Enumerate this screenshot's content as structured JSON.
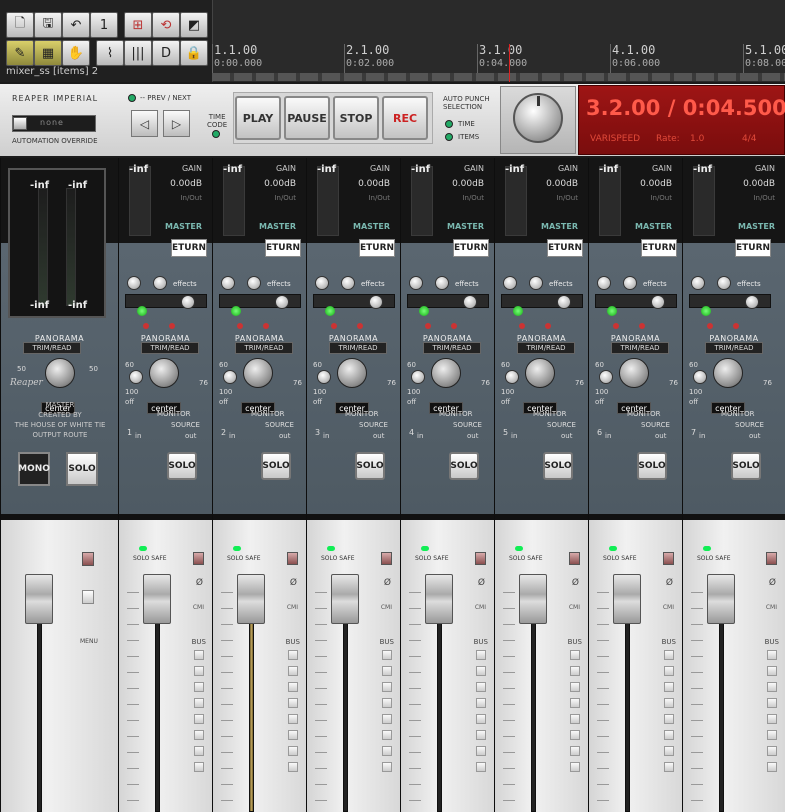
{
  "toolbar": {
    "buttons": [
      {
        "name": "new-project-icon",
        "glyph": "🗋"
      },
      {
        "name": "save-icon",
        "glyph": "🖫"
      },
      {
        "name": "undo-icon",
        "glyph": "↶"
      },
      {
        "name": "track-1-icon",
        "glyph": "1"
      },
      {
        "name": "grid-icon",
        "glyph": "⊞"
      },
      {
        "name": "snap-icon",
        "glyph": "⟲"
      },
      {
        "name": "metronome-icon",
        "glyph": "◩"
      },
      {
        "name": "record-cursor-icon",
        "glyph": "✎"
      },
      {
        "name": "ripple-icon",
        "glyph": "▦"
      },
      {
        "name": "hand-icon",
        "glyph": "✋"
      },
      {
        "name": "envelope-icon",
        "glyph": "⌇"
      },
      {
        "name": "lane-icon",
        "glyph": "|||"
      },
      {
        "name": "loop-icon",
        "glyph": "D"
      },
      {
        "name": "lock-icon",
        "glyph": "🔒"
      }
    ],
    "mixer_label": "mixer_ss [items] 2"
  },
  "ruler": {
    "marks": [
      {
        "bar": "1.1.00",
        "time": "0:00.000"
      },
      {
        "bar": "2.1.00",
        "time": "0:02.000"
      },
      {
        "bar": "3.1.00",
        "time": "0:04.000"
      },
      {
        "bar": "4.1.00",
        "time": "0:06.000"
      },
      {
        "bar": "5.1.00",
        "time": "0:08.000"
      }
    ]
  },
  "transport": {
    "brand": "REAPER IMPERIAL",
    "override_value": "none",
    "override_label": "AUTOMATION OVERRIDE",
    "prevnext_label": "-- PREV / NEXT",
    "prev_glyph": "◁",
    "next_glyph": "▷",
    "timecode_label_1": "TIME",
    "timecode_label_2": "CODE",
    "play": "PLAY",
    "pause": "PAUSE",
    "stop": "STOP",
    "rec": "REC",
    "autopunch_1": "AUTO PUNCH",
    "autopunch_2": "SELECTION",
    "ap_time": "TIME",
    "ap_items": "ITEMS"
  },
  "display": {
    "time": "3.2.00 / 0:04.500",
    "varispeed": "VARISPEED",
    "rate_label": "Rate:",
    "rate_value": "1.0",
    "signature": "4/4"
  },
  "master": {
    "meter_top_left": "-inf",
    "meter_top_right": "-inf",
    "meter_bottom_left": "-inf",
    "meter_bottom_right": "-inf",
    "logo": "Reaper",
    "credits_1": "MASTER",
    "credits_2": "CREATED BY",
    "credits_3": "THE HOUSE OF WHITE TIE",
    "output_route": "OUTPUT ROUTE",
    "panorama": "PANORAMA",
    "trim": "TRIM/READ",
    "pan_left": "50",
    "pan_right": "50",
    "center": "center",
    "mono": "MONO",
    "solo": "SOLO",
    "menu": "MENU"
  },
  "channels": [
    {
      "num": "1",
      "meter": "-inf",
      "gain_label": "GAIN",
      "gain": "0.00dB",
      "inout": "In/Out",
      "master": "MASTER",
      "fx": "ETURN",
      "effects": "effects",
      "panorama": "PANORAMA",
      "trim": "TRIM/READ",
      "center": "center",
      "monitor": "MONITOR",
      "source": "SOURCE",
      "in": "in",
      "out": "out",
      "solo": "SOLO",
      "solo_safe": "SOLO SAFE",
      "bus": "BUS",
      "phase": "Ø",
      "cmi": "CMI",
      "scale_60": "60",
      "scale_100": "100",
      "scale_off": "off",
      "scale_76": "76"
    },
    {
      "num": "2",
      "meter": "-inf",
      "gain_label": "GAIN",
      "gain": "0.00dB",
      "inout": "In/Out",
      "master": "MASTER",
      "fx": "ETURN",
      "effects": "effects",
      "panorama": "PANORAMA",
      "trim": "TRIM/READ",
      "center": "center",
      "monitor": "MONITOR",
      "source": "SOURCE",
      "in": "in",
      "out": "out",
      "solo": "SOLO",
      "solo_safe": "SOLO SAFE",
      "bus": "BUS",
      "phase": "Ø",
      "cmi": "CMI",
      "scale_60": "60",
      "scale_100": "100",
      "scale_off": "off",
      "scale_76": "76"
    },
    {
      "num": "3",
      "meter": "-inf",
      "gain_label": "GAIN",
      "gain": "0.00dB",
      "inout": "In/Out",
      "master": "MASTER",
      "fx": "ETURN",
      "effects": "effects",
      "panorama": "PANORAMA",
      "trim": "TRIM/READ",
      "center": "center",
      "monitor": "MONITOR",
      "source": "SOURCE",
      "in": "in",
      "out": "out",
      "solo": "SOLO",
      "solo_safe": "SOLO SAFE",
      "bus": "BUS",
      "phase": "Ø",
      "cmi": "CMI",
      "scale_60": "60",
      "scale_100": "100",
      "scale_off": "off",
      "scale_76": "76"
    },
    {
      "num": "4",
      "meter": "-inf",
      "gain_label": "GAIN",
      "gain": "0.00dB",
      "inout": "In/Out",
      "master": "MASTER",
      "fx": "ETURN",
      "effects": "effects",
      "panorama": "PANORAMA",
      "trim": "TRIM/READ",
      "center": "center",
      "monitor": "MONITOR",
      "source": "SOURCE",
      "in": "in",
      "out": "out",
      "solo": "SOLO",
      "solo_safe": "SOLO SAFE",
      "bus": "BUS",
      "phase": "Ø",
      "cmi": "CMI",
      "scale_60": "60",
      "scale_100": "100",
      "scale_off": "off",
      "scale_76": "76"
    },
    {
      "num": "5",
      "meter": "-inf",
      "gain_label": "GAIN",
      "gain": "0.00dB",
      "inout": "In/Out",
      "master": "MASTER",
      "fx": "ETURN",
      "effects": "effects",
      "panorama": "PANORAMA",
      "trim": "TRIM/READ",
      "center": "center",
      "monitor": "MONITOR",
      "source": "SOURCE",
      "in": "in",
      "out": "out",
      "solo": "SOLO",
      "solo_safe": "SOLO SAFE",
      "bus": "BUS",
      "phase": "Ø",
      "cmi": "CMI",
      "scale_60": "60",
      "scale_100": "100",
      "scale_off": "off",
      "scale_76": "76"
    },
    {
      "num": "6",
      "meter": "-inf",
      "gain_label": "GAIN",
      "gain": "0.00dB",
      "inout": "In/Out",
      "master": "MASTER",
      "fx": "ETURN",
      "effects": "effects",
      "panorama": "PANORAMA",
      "trim": "TRIM/READ",
      "center": "center",
      "monitor": "MONITOR",
      "source": "SOURCE",
      "in": "in",
      "out": "out",
      "solo": "SOLO",
      "solo_safe": "SOLO SAFE",
      "bus": "BUS",
      "phase": "Ø",
      "cmi": "CMI",
      "scale_60": "60",
      "scale_100": "100",
      "scale_off": "off",
      "scale_76": "76"
    },
    {
      "num": "7",
      "meter": "-inf",
      "gain_label": "GAIN",
      "gain": "0.00dB",
      "inout": "In/Out",
      "master": "MASTER",
      "fx": "ETURN",
      "effects": "effects",
      "panorama": "PANORAMA",
      "trim": "TRIM/READ",
      "center": "center",
      "monitor": "MONITOR",
      "source": "SOURCE",
      "in": "in",
      "out": "out",
      "solo": "SOLO",
      "solo_safe": "SOLO SAFE",
      "bus": "BUS",
      "phase": "Ø",
      "cmi": "CMI",
      "scale_60": "60",
      "scale_100": "100",
      "scale_off": "off",
      "scale_76": "76"
    }
  ],
  "colors": {
    "display_red": "#ff5a4a",
    "accent_green": "#1e5",
    "master_teal": "#7ab8b0"
  }
}
